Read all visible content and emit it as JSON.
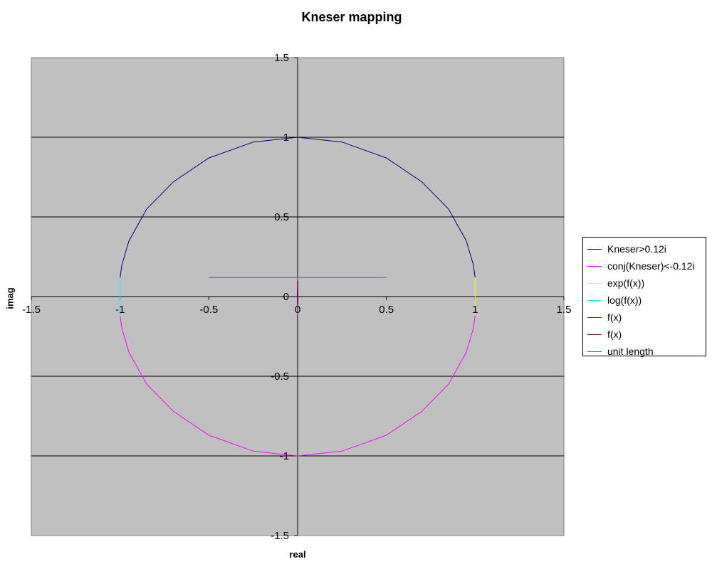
{
  "chart_data": {
    "type": "scatter",
    "title": "Kneser mapping",
    "xlabel": "real",
    "ylabel": "imag",
    "xlim": [
      -1.5,
      1.5
    ],
    "ylim": [
      -1.5,
      1.5
    ],
    "x_ticks": [
      "-1.5",
      "-1",
      "-0.5",
      "0",
      "0.5",
      "1",
      "1.5"
    ],
    "y_ticks": [
      "1.5",
      "1",
      "0.5",
      "0",
      "-0.5",
      "-1",
      "-1.5"
    ],
    "grid": "horizontal",
    "legend_position": "right",
    "plot_background": "#c0c0c0",
    "series": [
      {
        "name": "Kneser>0.12i",
        "color": "#000080",
        "points": [
          [
            1.0,
            0.12
          ],
          [
            0.99,
            0.2
          ],
          [
            0.95,
            0.35
          ],
          [
            0.85,
            0.55
          ],
          [
            0.7,
            0.72
          ],
          [
            0.5,
            0.87
          ],
          [
            0.25,
            0.97
          ],
          [
            0.0,
            1.0
          ],
          [
            -0.25,
            0.97
          ],
          [
            -0.5,
            0.87
          ],
          [
            -0.7,
            0.72
          ],
          [
            -0.85,
            0.55
          ],
          [
            -0.95,
            0.35
          ],
          [
            -0.99,
            0.2
          ],
          [
            -1.0,
            0.12
          ]
        ]
      },
      {
        "name": "conj(Kneser)<-0.12i",
        "color": "#ff00ff",
        "points": [
          [
            1.0,
            -0.12
          ],
          [
            0.99,
            -0.2
          ],
          [
            0.95,
            -0.35
          ],
          [
            0.85,
            -0.55
          ],
          [
            0.7,
            -0.72
          ],
          [
            0.5,
            -0.87
          ],
          [
            0.25,
            -0.97
          ],
          [
            0.0,
            -1.0
          ],
          [
            -0.25,
            -0.97
          ],
          [
            -0.5,
            -0.87
          ],
          [
            -0.7,
            -0.72
          ],
          [
            -0.85,
            -0.55
          ],
          [
            -0.95,
            -0.35
          ],
          [
            -0.99,
            -0.2
          ],
          [
            -1.0,
            -0.12
          ]
        ]
      },
      {
        "name": "exp(f(x))",
        "color": "#ffff00",
        "points": [
          [
            1.0,
            0.12
          ],
          [
            1.0,
            0.0
          ],
          [
            1.0,
            -0.12
          ]
        ]
      },
      {
        "name": "log(f(x))",
        "color": "#00ffff",
        "points": [
          [
            -1.0,
            0.12
          ],
          [
            -1.0,
            0.0
          ],
          [
            -1.0,
            -0.12
          ]
        ]
      },
      {
        "name": "f(x)",
        "color": "#800080",
        "points": [
          [
            0.0,
            0.12
          ],
          [
            -0.002,
            0.0
          ],
          [
            0.0,
            -0.12
          ]
        ]
      },
      {
        "name": "f(x)",
        "color": "#800000",
        "points": [
          [
            0.002,
            0.1
          ],
          [
            0.002,
            -0.05
          ]
        ]
      },
      {
        "name": "unit length",
        "color": "#008080",
        "points": [
          [
            -0.5,
            0.12
          ],
          [
            0.5,
            0.12
          ]
        ]
      }
    ]
  }
}
